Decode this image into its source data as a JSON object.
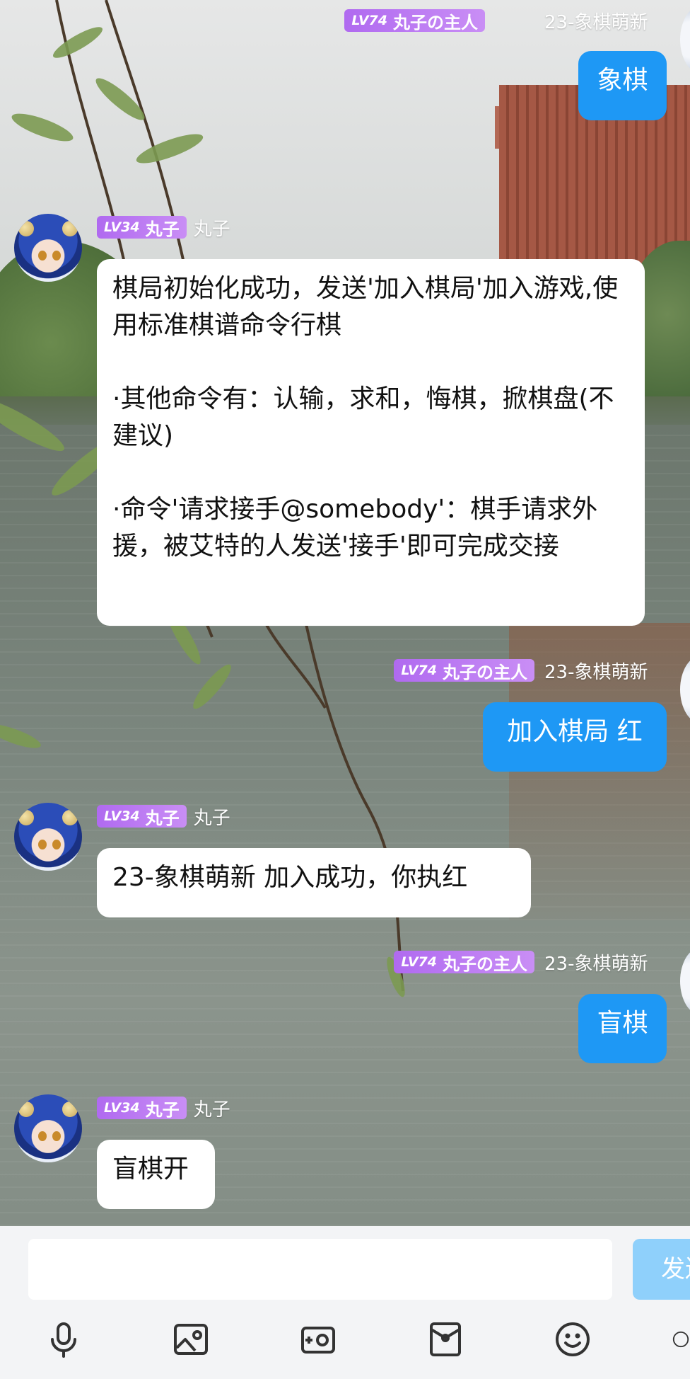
{
  "messages": [
    {
      "side": "right",
      "level": "LV74",
      "title": "丸子の主人",
      "nick": "23-象棋萌新",
      "text": "象棋"
    },
    {
      "side": "left",
      "level": "LV34",
      "title": "丸子",
      "nick": "丸子",
      "text": "棋局初始化成功，发送'加入棋局'加入游戏,使用标准棋谱命令行棋\n\n·其他命令有：认输，求和，悔棋，掀棋盘(不建议)\n\n·命令'请求接手@somebody'：棋手请求外援，被艾特的人发送'接手'即可完成交接"
    },
    {
      "side": "right",
      "level": "LV74",
      "title": "丸子の主人",
      "nick": "23-象棋萌新",
      "text": "加入棋局 红"
    },
    {
      "side": "left",
      "level": "LV34",
      "title": "丸子",
      "nick": "丸子",
      "text": "23-象棋萌新 加入成功，你执红"
    },
    {
      "side": "right",
      "level": "LV74",
      "title": "丸子の主人",
      "nick": "23-象棋萌新",
      "text": "盲棋"
    },
    {
      "side": "left",
      "level": "LV34",
      "title": "丸子",
      "nick": "丸子",
      "text": "盲棋开"
    }
  ],
  "input": {
    "value": "",
    "send_label": "发送"
  },
  "toolbar": {
    "icons": [
      "microphone-icon",
      "image-icon",
      "camera-icon",
      "red-packet-icon",
      "emoji-icon",
      "more-icon"
    ]
  },
  "colors": {
    "bubble_right": "#1e98f5",
    "bubble_left": "#ffffff",
    "badge": "#b06af0",
    "send_button": "#8fd0fb",
    "input_bar": "#f3f4f6"
  }
}
